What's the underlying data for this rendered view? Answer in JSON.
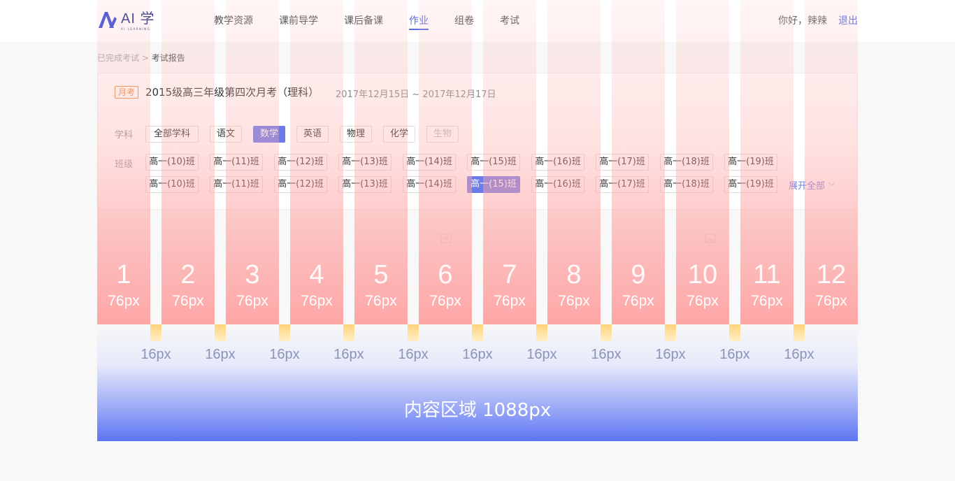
{
  "header": {
    "logo_text": "AI 学",
    "logo_sub": "AI LEARNING",
    "nav": [
      "教学资源",
      "课前导学",
      "课后备课",
      "作业",
      "组卷",
      "考试"
    ],
    "active_nav": 3,
    "greeting": "你好，辣辣",
    "logout": "退出"
  },
  "breadcrumb": {
    "parent": "已完成考试",
    "sep": " > ",
    "current": "考试报告"
  },
  "exam": {
    "tag": "月考",
    "title": "2015级高三年级第四次月考（理科）",
    "date": "2017年12月15日 ~ 2017年12月17日"
  },
  "filters": {
    "subject_label": "学科",
    "subjects": [
      "全部学科",
      "语文",
      "数学",
      "英语",
      "物理",
      "化学",
      "生物"
    ],
    "class_label": "班级",
    "classes_row1": [
      "高一(10)班",
      "高一(11)班",
      "高一(12)班",
      "高一(13)班",
      "高一(14)班",
      "高一(15)班",
      "高一(16)班",
      "高一(17)班",
      "高一(18)班",
      "高一(19)班"
    ],
    "classes_row2": [
      "高一(10)班",
      "高一(11)班",
      "高一(12)班",
      "高一(13)班",
      "高一(14)班",
      "高一(15)班",
      "高一(16)班",
      "高一(17)班",
      "高一(18)班",
      "高一(19)班"
    ],
    "expand": "展开全部"
  },
  "grid": {
    "columns": [
      "1",
      "2",
      "3",
      "4",
      "5",
      "6",
      "7",
      "8",
      "9",
      "10",
      "11",
      "12"
    ],
    "column_width_label": "76px",
    "gutter_label": "16px",
    "content_label": "内容区域 1088px"
  },
  "colors": {
    "accent": "#5b6ee1",
    "chip_active": "#6b7bea",
    "tag": "#f08c3c"
  }
}
